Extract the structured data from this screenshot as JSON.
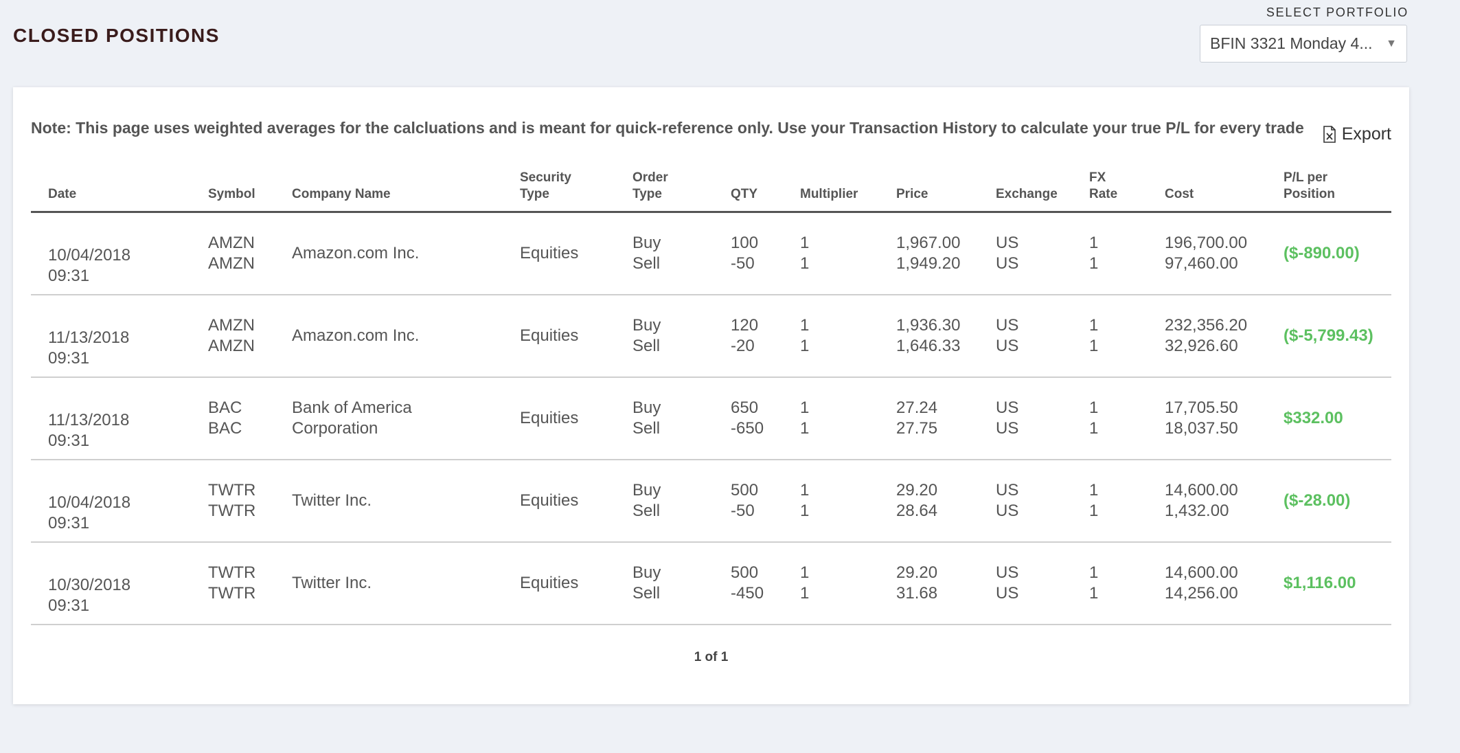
{
  "header": {
    "title": "CLOSED POSITIONS",
    "portfolio_label": "SELECT PORTFOLIO",
    "portfolio_value": "BFIN 3321 Monday 4..."
  },
  "note": "Note: This page uses weighted averages for the calcluations and is meant for quick-reference only. Use your Transaction History to calculate your true P/L for every trade",
  "export_label": "Export",
  "table": {
    "columns": {
      "date": "Date",
      "symbol": "Symbol",
      "company": "Company Name",
      "security_type_1": "Security",
      "security_type_2": "Type",
      "order_type_1": "Order",
      "order_type_2": "Type",
      "qty": "QTY",
      "multiplier": "Multiplier",
      "price": "Price",
      "exchange": "Exchange",
      "fx_1": "FX",
      "fx_2": "Rate",
      "cost": "Cost",
      "pl_1": "P/L per",
      "pl_2": "Position"
    },
    "rows": [
      {
        "date": "10/04/2018",
        "time": "09:31",
        "sym1": "AMZN",
        "sym2": "AMZN",
        "company1": "Amazon.com Inc.",
        "company2": "",
        "security_type": "Equities",
        "order1": "Buy",
        "order2": "Sell",
        "qty1": "100",
        "qty2": "-50",
        "mult1": "1",
        "mult2": "1",
        "price1": "1,967.00",
        "price2": "1,949.20",
        "exch1": "US",
        "exch2": "US",
        "fx1": "1",
        "fx2": "1",
        "cost1": "196,700.00",
        "cost2": "97,460.00",
        "pl": "($-890.00)"
      },
      {
        "date": "11/13/2018",
        "time": "09:31",
        "sym1": "AMZN",
        "sym2": "AMZN",
        "company1": "Amazon.com Inc.",
        "company2": "",
        "security_type": "Equities",
        "order1": "Buy",
        "order2": "Sell",
        "qty1": "120",
        "qty2": "-20",
        "mult1": "1",
        "mult2": "1",
        "price1": "1,936.30",
        "price2": "1,646.33",
        "exch1": "US",
        "exch2": "US",
        "fx1": "1",
        "fx2": "1",
        "cost1": "232,356.20",
        "cost2": "32,926.60",
        "pl": "($-5,799.43)"
      },
      {
        "date": "11/13/2018",
        "time": "09:31",
        "sym1": "BAC",
        "sym2": "BAC",
        "company1": "Bank of America",
        "company2": "Corporation",
        "security_type": "Equities",
        "order1": "Buy",
        "order2": "Sell",
        "qty1": "650",
        "qty2": "-650",
        "mult1": "1",
        "mult2": "1",
        "price1": "27.24",
        "price2": "27.75",
        "exch1": "US",
        "exch2": "US",
        "fx1": "1",
        "fx2": "1",
        "cost1": "17,705.50",
        "cost2": "18,037.50",
        "pl": "$332.00"
      },
      {
        "date": "10/04/2018",
        "time": "09:31",
        "sym1": "TWTR",
        "sym2": "TWTR",
        "company1": "Twitter Inc.",
        "company2": "",
        "security_type": "Equities",
        "order1": "Buy",
        "order2": "Sell",
        "qty1": "500",
        "qty2": "-50",
        "mult1": "1",
        "mult2": "1",
        "price1": "29.20",
        "price2": "28.64",
        "exch1": "US",
        "exch2": "US",
        "fx1": "1",
        "fx2": "1",
        "cost1": "14,600.00",
        "cost2": "1,432.00",
        "pl": "($-28.00)"
      },
      {
        "date": "10/30/2018",
        "time": "09:31",
        "sym1": "TWTR",
        "sym2": "TWTR",
        "company1": "Twitter Inc.",
        "company2": "",
        "security_type": "Equities",
        "order1": "Buy",
        "order2": "Sell",
        "qty1": "500",
        "qty2": "-450",
        "mult1": "1",
        "mult2": "1",
        "price1": "29.20",
        "price2": "31.68",
        "exch1": "US",
        "exch2": "US",
        "fx1": "1",
        "fx2": "1",
        "cost1": "14,600.00",
        "cost2": "14,256.00",
        "pl": "$1,116.00"
      }
    ]
  },
  "pagination": "1 of 1",
  "colors": {
    "pl_positive": "#5cc060",
    "title": "#3a1c1c",
    "background": "#eef1f6"
  }
}
